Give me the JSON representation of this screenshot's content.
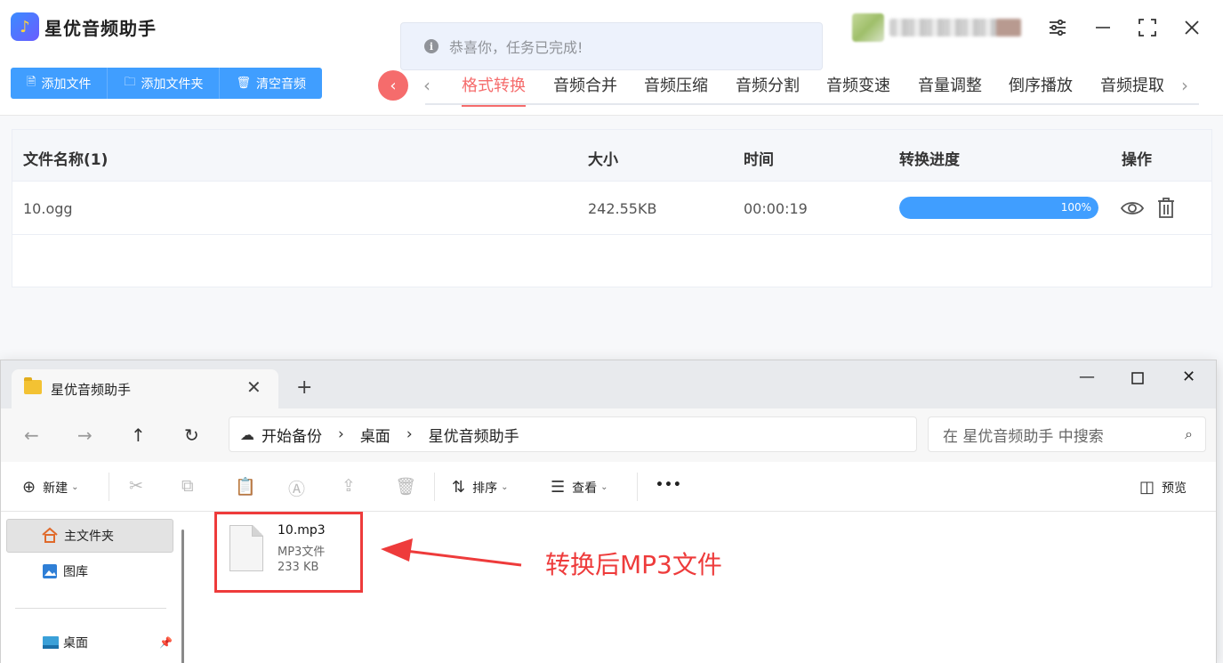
{
  "app": {
    "title": "星优音频助手",
    "toast": "恭喜你，任务已完成!",
    "buttons": [
      {
        "label": "添加文件"
      },
      {
        "label": "添加文件夹"
      },
      {
        "label": "清空音频"
      }
    ],
    "tabs": [
      {
        "label": "格式转换",
        "active": true
      },
      {
        "label": "音频合并"
      },
      {
        "label": "音频压缩"
      },
      {
        "label": "音频分割"
      },
      {
        "label": "音频变速"
      },
      {
        "label": "音量调整"
      },
      {
        "label": "倒序播放"
      },
      {
        "label": "音频提取"
      }
    ],
    "table": {
      "headers": {
        "name": "文件名称(1)",
        "size": "大小",
        "time": "时间",
        "progress": "转换进度",
        "ops": "操作"
      },
      "rows": [
        {
          "name": "10.ogg",
          "size": "242.55KB",
          "time": "00:00:19",
          "progress_label": "100%",
          "progress": 1.0
        }
      ]
    },
    "colors": {
      "accent": "#409eff",
      "active_tab": "#f56c6c"
    }
  },
  "explorer": {
    "tab_title": "星优音频助手",
    "breadcrumb": [
      "开始备份",
      "桌面",
      "星优音频助手"
    ],
    "search_placeholder": "在 星优音频助手 中搜索",
    "toolbar": {
      "new": "新建",
      "sort": "排序",
      "view": "查看",
      "more": "•••",
      "preview": "预览"
    },
    "nav": [
      {
        "label": "主文件夹",
        "icon": "home-icon",
        "selected": true
      },
      {
        "label": "图库",
        "icon": "gallery-icon"
      },
      {
        "label": "桌面",
        "icon": "desktop-icon"
      }
    ],
    "file": {
      "name": "10.mp3",
      "type": "MP3文件",
      "size": "233 KB"
    },
    "annotation": "转换后MP3文件",
    "colors": {
      "highlight": "#ee3b3b"
    }
  }
}
